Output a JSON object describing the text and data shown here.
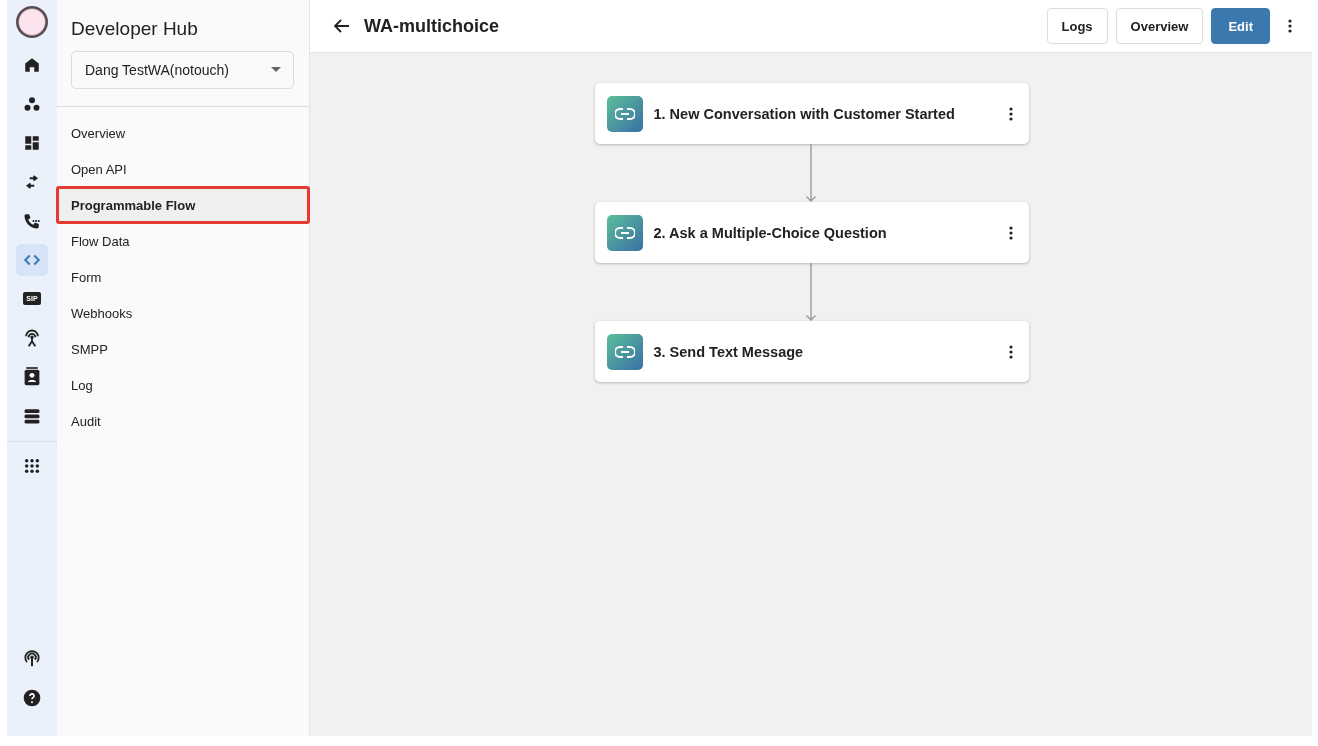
{
  "rail": {
    "items": [
      {
        "selected": false
      },
      {
        "selected": false
      },
      {
        "selected": false
      },
      {
        "selected": false
      },
      {
        "selected": false
      },
      {
        "selected": true
      },
      {
        "selected": false,
        "label": "SIP"
      },
      {
        "selected": false
      },
      {
        "selected": false
      },
      {
        "selected": false
      },
      {
        "selected": false
      }
    ],
    "bottom_items": [
      {
        "selected": false
      },
      {
        "selected": false
      }
    ]
  },
  "sidebar": {
    "title": "Developer Hub",
    "account_select": {
      "value": "Dang TestWA(notouch)"
    },
    "items": [
      {
        "label": "Overview",
        "selected": false
      },
      {
        "label": "Open API",
        "selected": false
      },
      {
        "label": "Programmable Flow",
        "selected": true
      },
      {
        "label": "Flow Data",
        "selected": false
      },
      {
        "label": "Form",
        "selected": false
      },
      {
        "label": "Webhooks",
        "selected": false
      },
      {
        "label": "SMPP",
        "selected": false
      },
      {
        "label": "Log",
        "selected": false
      },
      {
        "label": "Audit",
        "selected": false
      }
    ]
  },
  "header": {
    "title": "WA-multichoice",
    "buttons": [
      {
        "label": "Logs",
        "kind": "outline"
      },
      {
        "label": "Overview",
        "kind": "outline"
      },
      {
        "label": "Edit",
        "kind": "primary"
      }
    ]
  },
  "flow": {
    "nodes": [
      {
        "title": "1. New Conversation with Customer Started"
      },
      {
        "title": "2. Ask a Multiple-Choice Question"
      },
      {
        "title": "3. Send Text Message"
      }
    ]
  }
}
